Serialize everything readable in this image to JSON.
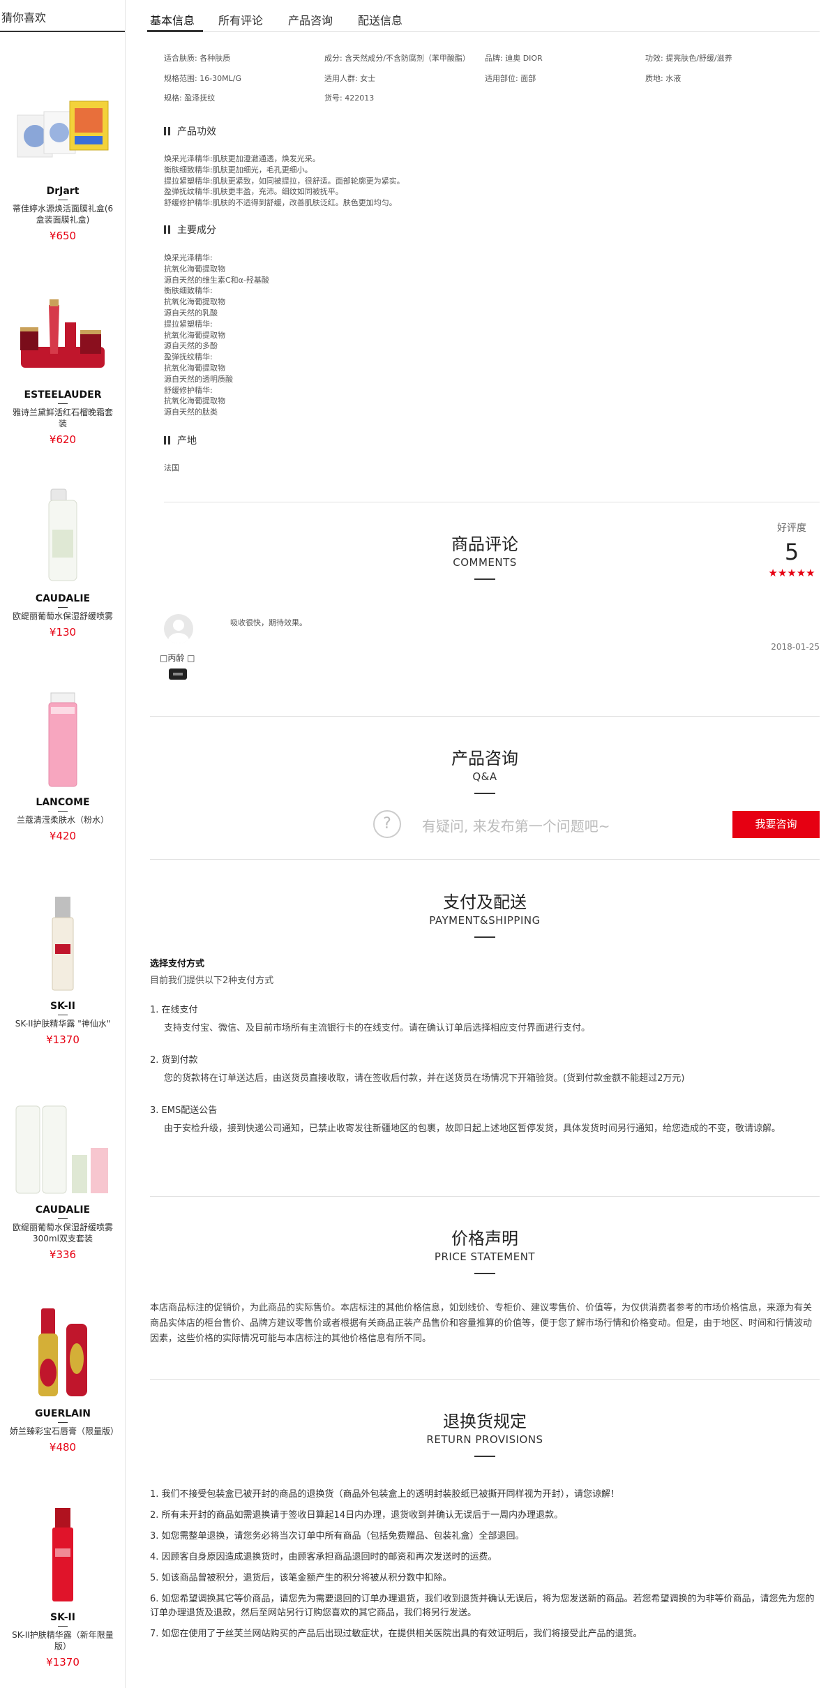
{
  "sidebar": {
    "title": "猜你喜欢",
    "items": [
      {
        "brand": "DrJart",
        "name": "蒂佳婷水源焕活面膜礼盒(6盒装面膜礼盒)",
        "price": "¥650"
      },
      {
        "brand": "ESTEELAUDER",
        "name": "雅诗兰黛鲜活红石榴晚霜套装",
        "price": "¥620"
      },
      {
        "brand": "CAUDALIE",
        "name": "欧缇丽葡萄水保湿舒缓喷雾",
        "price": "¥130"
      },
      {
        "brand": "LANCOME",
        "name": "兰蔻清滢柔肤水（粉水）",
        "price": "¥420"
      },
      {
        "brand": "SK-II",
        "name": "SK-II护肤精华露 \"神仙水\"",
        "price": "¥1370"
      },
      {
        "brand": "CAUDALIE",
        "name": "欧缇丽葡萄水保湿舒缓喷雾300ml双支套装",
        "price": "¥336"
      },
      {
        "brand": "GUERLAIN",
        "name": "娇兰臻彩宝石唇膏（限量版）",
        "price": "¥480"
      },
      {
        "brand": "SK-II",
        "name": "SK-II护肤精华露（新年限量版）",
        "price": "¥1370"
      }
    ]
  },
  "tabs": [
    "基本信息",
    "所有评论",
    "产品咨询",
    "配送信息"
  ],
  "attributes": {
    "skin_type": "适合肤质: 各种肤质",
    "ingredients": "成分: 含天然成分/不含防腐剂（苯甲酸酯）",
    "brand": "品牌: 迪奥 DIOR",
    "effect": "功效: 提亮肤色/舒缓/滋养",
    "spec_range": "规格范围: 16-30ML/G",
    "audience": "适用人群: 女士",
    "area": "适用部位: 面部",
    "texture": "质地: 水液",
    "spec": "规格: 盈泽抚纹",
    "item_no": "货号: 422013"
  },
  "efficacy": {
    "title": "产品功效",
    "lines": [
      "焕采光泽精华:肌肤更加澄澈通透，焕发光采。",
      "衡肤细致精华:肌肤更加细光，毛孔更细小。",
      "提拉紧塑精华:肌肤更紧致，如同被提拉，很舒适。面部轮廓更为紧实。",
      "盈弹抚纹精华:肌肤更丰盈，充沛。细纹如同被抚平。",
      "舒缓修护精华:肌肤的不适得到舒缓，改善肌肤泛红。肤色更加均匀。"
    ]
  },
  "composition": {
    "title": "主要成分",
    "lines": [
      "焕采光泽精华:",
      "抗氧化海葡提取物",
      "源自天然的维生素C和α-羟基酸",
      "衡肤细致精华:",
      "抗氧化海葡提取物",
      "源自天然的乳酸",
      "提拉紧塑精华:",
      "抗氧化海葡提取物",
      "源自天然的多酚",
      "盈弹抚纹精华:",
      "抗氧化海葡提取物",
      "源自天然的透明质酸",
      "舒缓修护精华:",
      "抗氧化海葡提取物",
      "源自天然的肽类"
    ]
  },
  "origin": {
    "title": "产地",
    "value": "法国"
  },
  "comments": {
    "title_cn": "商品评论",
    "title_en": "COMMENTS",
    "rating_label": "好评度",
    "rating_score": "5",
    "stars": "★★★★★",
    "review": {
      "user": "□丙龄 □",
      "text": "吸收很快，期待效果。",
      "date": "2018-01-25"
    }
  },
  "qa": {
    "title_cn": "产品咨询",
    "title_en": "Q&A",
    "icon": "question-icon",
    "prompt": "有疑问, 来发布第一个问题吧~",
    "button": "我要咨询"
  },
  "payment": {
    "title_cn": "支付及配送",
    "title_en": "PAYMENT&SHIPPING",
    "heading": "选择支付方式",
    "subheading": "目前我们提供以下2种支付方式",
    "items": [
      {
        "title": "1. 在线支付",
        "desc": "支持支付宝、微信、及目前市场所有主流银行卡的在线支付。请在确认订单后选择相应支付界面进行支付。"
      },
      {
        "title": "2. 货到付款",
        "desc": "您的货款将在订单送达后，由送货员直接收取，请在签收后付款，并在送货员在场情况下开箱验货。(货到付款金额不能超过2万元)"
      },
      {
        "title": "3. EMS配送公告",
        "desc": "由于安检升级，接到快递公司通知，已禁止收寄发往新疆地区的包裹，故即日起上述地区暂停发货，具体发货时间另行通知，给您造成的不变，敬请谅解。"
      }
    ]
  },
  "price_statement": {
    "title_cn": "价格声明",
    "title_en": "PRICE STATEMENT",
    "text": "本店商品标注的促销价，为此商品的实际售价。本店标注的其他价格信息，如划线价、专柜价、建议零售价、价值等，为仅供消费者参考的市场价格信息，来源为有关商品实体店的柜台售价、品牌方建议零售价或者根据有关商品正装产品售价和容量推算的价值等，便于您了解市场行情和价格变动。但是，由于地区、时间和行情波动因素，这些价格的实际情况可能与本店标注的其他价格信息有所不同。"
  },
  "returns": {
    "title_cn": "退换货规定",
    "title_en": "RETURN PROVISIONS",
    "items": [
      "1. 我们不接受包装盒已被开封的商品的退换货（商品外包装盒上的透明封装胶纸已被撕开同样视为开封），请您谅解！",
      "2. 所有未开封的商品如需退换请于签收日算起14日内办理，退货收到并确认无误后于一周内办理退款。",
      "3. 如您需整单退换，请您务必将当次订单中所有商品（包括免费赠品、包装礼盒）全部退回。",
      "4. 因顾客自身原因造成退换货时，由顾客承担商品退回时的邮资和再次发送时的运费。",
      "5. 如该商品曾被积分，退货后，该笔金额产生的积分将被从积分数中扣除。",
      "6. 如您希望调换其它等价商品，请您先为需要退回的订单办理退货，我们收到退货并确认无误后，将为您发送新的商品。若您希望调换的为非等价商品，请您先为您的订单办理退货及退款，然后至网站另行订购您喜欢的其它商品，我们将另行发送。",
      "7. 如您在使用了于丝芙兰网站购买的产品后出现过敏症状，在提供相关医院出具的有效证明后，我们将接受此产品的退货。"
    ]
  },
  "colors": {
    "accent": "#e60012",
    "text": "#333333",
    "border": "#e0e0e0"
  }
}
